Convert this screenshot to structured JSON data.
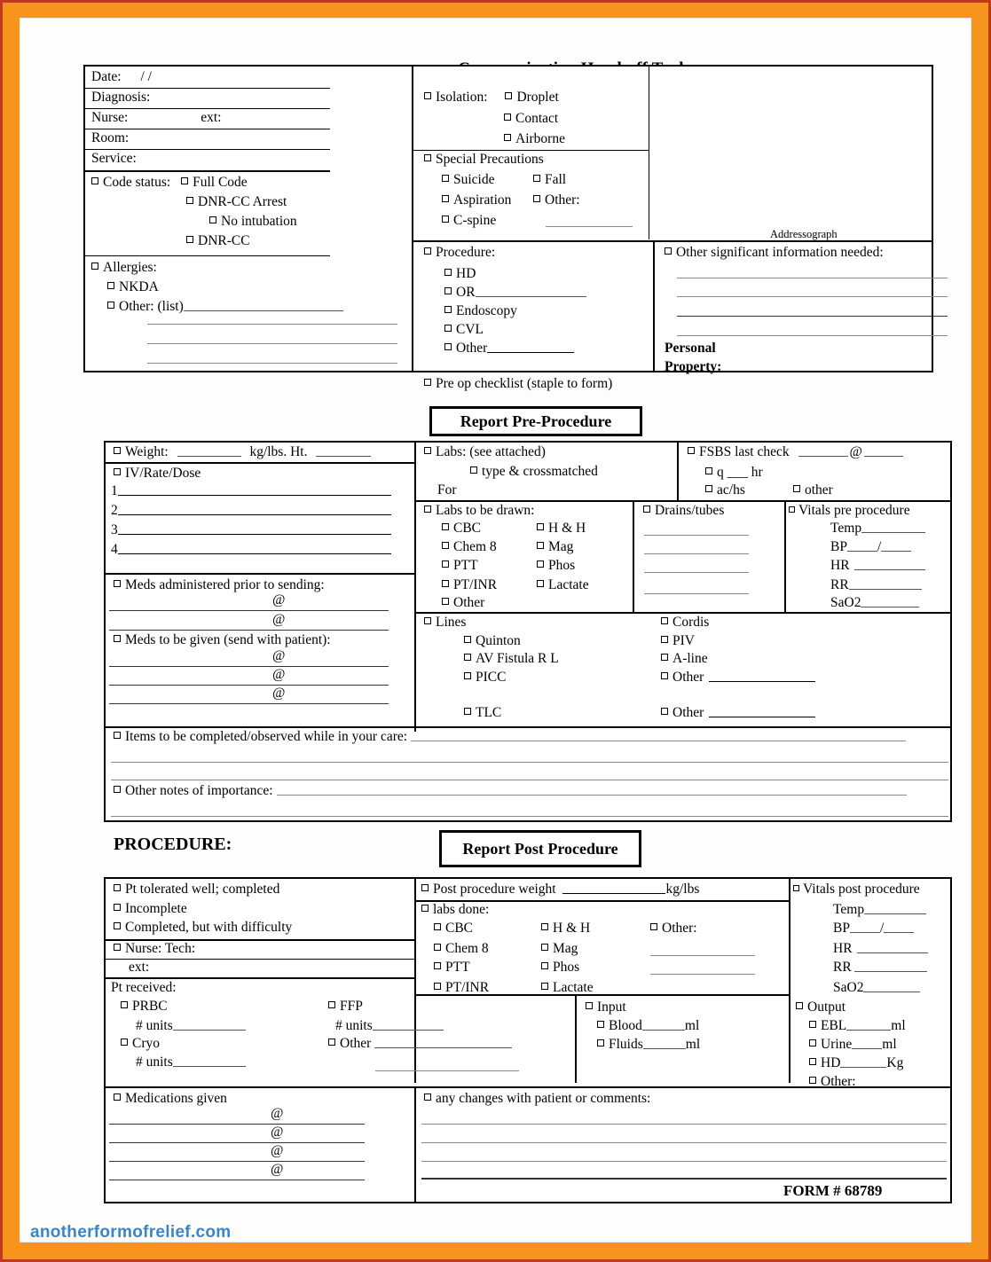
{
  "document": {
    "title": "Communication Hand-off Tool",
    "form_number": "FORM  # 68789",
    "addressograph_label": "Addressograph",
    "watermark": "anotherformofrelief.com",
    "border_color": "#f7941e",
    "watermark_color": "#3d85c6"
  },
  "header": {
    "patient_fields": [
      {
        "label": "Date:",
        "value": "/     /"
      },
      {
        "label": "Diagnosis:",
        "value": ""
      },
      {
        "label": "Nurse:",
        "value": "ext:"
      },
      {
        "label": "Room:",
        "value": ""
      },
      {
        "label": "Service:",
        "value": ""
      }
    ],
    "code_status": {
      "label": "Code status:",
      "options": [
        "Full Code",
        "DNR-CC Arrest",
        "No intubation",
        "DNR-CC"
      ]
    },
    "allergies": {
      "label": "Allergies:",
      "options": [
        "NKDA",
        "Other: (list)"
      ]
    },
    "isolation": {
      "label": "Isolation:",
      "options": [
        "Droplet",
        "Contact",
        "Airborne"
      ]
    },
    "special_precautions": {
      "label": "Special Precautions",
      "options": [
        "Suicide",
        "Fall",
        "Aspiration",
        "Other:",
        "C-spine"
      ]
    },
    "procedure": {
      "label": "Procedure:",
      "options": [
        "HD",
        "OR",
        "Endoscopy",
        "CVL",
        "Other"
      ],
      "preop": "Pre op checklist (staple to form)"
    },
    "other_info": {
      "label": "Other significant information needed:",
      "personal_property": "Personal Property:"
    }
  },
  "pre_procedure": {
    "badge": "Report Pre-Procedure",
    "weight": {
      "label": "Weight:",
      "unit": "kg/lbs.  Ht."
    },
    "iv": {
      "label": "IV/Rate/Dose",
      "rows": [
        "1",
        "2",
        "3",
        "4"
      ]
    },
    "meds_prior": {
      "label": "Meds administered prior to sending:",
      "lines": [
        "@",
        "@"
      ]
    },
    "meds_given": {
      "label": "Meds to be given (send with patient):",
      "lines": [
        "@",
        "@",
        "@"
      ]
    },
    "labs": {
      "label": "Labs: (see attached)",
      "crossmatch": "type & crossmatched",
      "for": "For"
    },
    "fsbs": {
      "label": "FSBS last check",
      "at": "@",
      "options": [
        "q ___ hr",
        "ac/hs",
        "other"
      ]
    },
    "labs_to_draw": {
      "label": "Labs to be drawn:",
      "col1": [
        "CBC",
        "Chem 8",
        "PTT",
        "PT/INR",
        "Other"
      ],
      "col2": [
        "H & H",
        "Mag",
        "Phos",
        "Lactate"
      ]
    },
    "drains": {
      "label": "Drains/tubes"
    },
    "vitals": {
      "label": "Vitals pre procedure",
      "items": [
        "Temp",
        "BP",
        "HR",
        "RR",
        "SaO2"
      ],
      "bp_separator": "/"
    },
    "lines": {
      "label": "Lines",
      "col1": [
        "Quinton",
        "AV Fistula   R   L",
        "PICC",
        "TLC"
      ],
      "col2": [
        "Cordis",
        "PIV",
        "A-line",
        "Other",
        "Other"
      ]
    },
    "items_to_complete": "Items to be completed/observed while in your care:",
    "other_notes": "Other notes of importance:"
  },
  "post_procedure": {
    "section_label": "PROCEDURE:",
    "badge": "Report Post Procedure",
    "tolerance": [
      "Pt tolerated well; completed",
      "Incomplete",
      "Completed, but with difficulty"
    ],
    "nurse_tech": {
      "label": "Nurse: Tech:",
      "ext": "ext:"
    },
    "pt_received": {
      "label": "Pt received:",
      "col1": [
        {
          "name": "PRBC",
          "units": "# units"
        },
        {
          "name": "Cryo",
          "units": "# units"
        }
      ],
      "col2": [
        {
          "name": "FFP",
          "units": "# units"
        },
        {
          "name": "Other",
          "units": ""
        }
      ]
    },
    "post_weight": {
      "label": "Post procedure weight",
      "unit": "kg/lbs"
    },
    "labs_done": {
      "label": "labs done:",
      "col1": [
        "CBC",
        "Chem 8",
        "PTT",
        "PT/INR"
      ],
      "col2": [
        "H & H",
        "Mag",
        "Phos",
        "Lactate"
      ],
      "other": "Other:"
    },
    "vitals_post": {
      "label": "Vitals post procedure",
      "items": [
        "Temp",
        "BP",
        "HR",
        "RR",
        "SaO2"
      ],
      "bp_separator": "/"
    },
    "input": {
      "label": "Input",
      "items": [
        "Blood",
        "Fluids"
      ],
      "unit": "ml"
    },
    "output": {
      "label": "Output",
      "items": [
        {
          "name": "EBL",
          "unit": "ml"
        },
        {
          "name": "Urine",
          "unit": "ml"
        },
        {
          "name": "HD",
          "unit": "Kg"
        },
        {
          "name": "Other:",
          "unit": ""
        }
      ]
    },
    "medications_given": {
      "label": "Medications given",
      "lines": [
        "@",
        "@",
        "@",
        "@"
      ]
    },
    "changes": {
      "label": "any changes with patient or comments:"
    }
  }
}
